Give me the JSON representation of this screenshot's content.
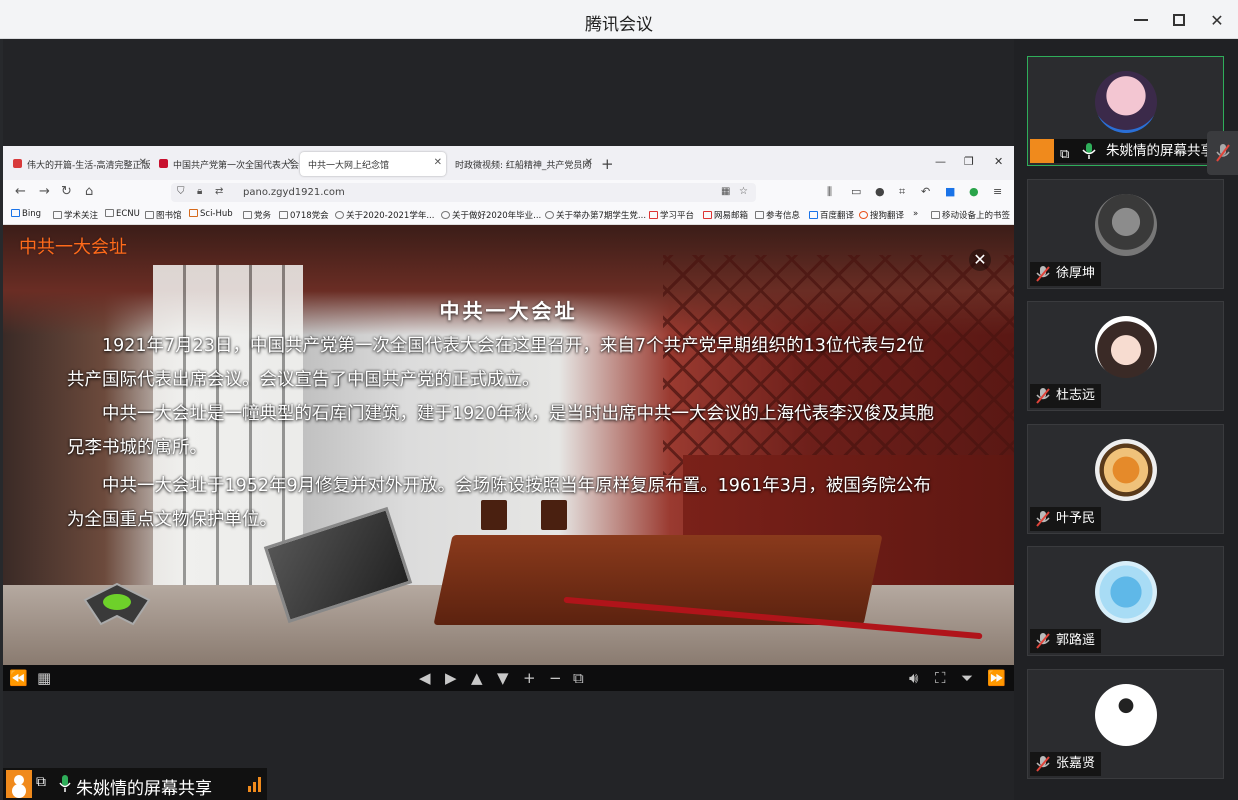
{
  "app": {
    "title": "腾讯会议"
  },
  "browser": {
    "tabs": [
      {
        "title": "伟大的开篇-生活-高清完整正版",
        "fav_color": "#d83a3a"
      },
      {
        "title": "中国共产党第一次全国代表大会",
        "fav_color": "#c8102e"
      },
      {
        "title": "中共一大网上纪念馆",
        "fav_color": "#888888"
      },
      {
        "title": "时政微视频: 红船精神_共产党员网",
        "fav_color": "#cccccc"
      }
    ],
    "url": "pano.zgyd1921.com",
    "bookmarks": [
      "Bing",
      "学术关注",
      "ECNU",
      "图书馆",
      "Sci-Hub",
      "党务",
      "0718党会",
      "关于2020-2021学年...",
      "关于做好2020年毕业...",
      "关于举办第7期学生党...",
      "学习平台",
      "网易邮箱",
      "参考信息",
      "百度翻译",
      "搜狗翻译",
      "移动设备上的书签"
    ]
  },
  "pano": {
    "brand": "中共一大会址",
    "heading": "中共一大会址",
    "paragraphs": [
      "1921年7月23日，中国共产党第一次全国代表大会在这里召开，来自7个共产党早期组织的13位代表与2位共产国际代表出席会议。会议宣告了中国共产党的正式成立。",
      "中共一大会址是一幢典型的石库门建筑，建于1920年秋，是当时出席中共一大会议的上海代表李汉俊及其胞兄李书城的寓所。",
      "中共一大会址于1952年9月修复并对外开放。会场陈设按照当年原样复原布置。1961年3月，被国务院公布为全国重点文物保护单位。"
    ]
  },
  "share": {
    "name": "朱姚情的屏幕共享"
  },
  "participants": [
    {
      "name": "朱姚情的屏幕共享",
      "active": true,
      "avatar": "anime-girl-mask"
    },
    {
      "name": "徐厚坤",
      "active": false,
      "avatar": "portrait-man"
    },
    {
      "name": "杜志远",
      "active": false,
      "avatar": "cat-ears-girl"
    },
    {
      "name": "叶予民",
      "active": false,
      "avatar": "tiger"
    },
    {
      "name": "郭路遥",
      "active": false,
      "avatar": "dolphin"
    },
    {
      "name": "张嘉贤",
      "active": false,
      "avatar": "sketch-figure"
    }
  ],
  "colors": {
    "accent_green": "#2fae5a",
    "accent_orange": "#f08a1c",
    "brand_orange": "#ff6a1a"
  }
}
